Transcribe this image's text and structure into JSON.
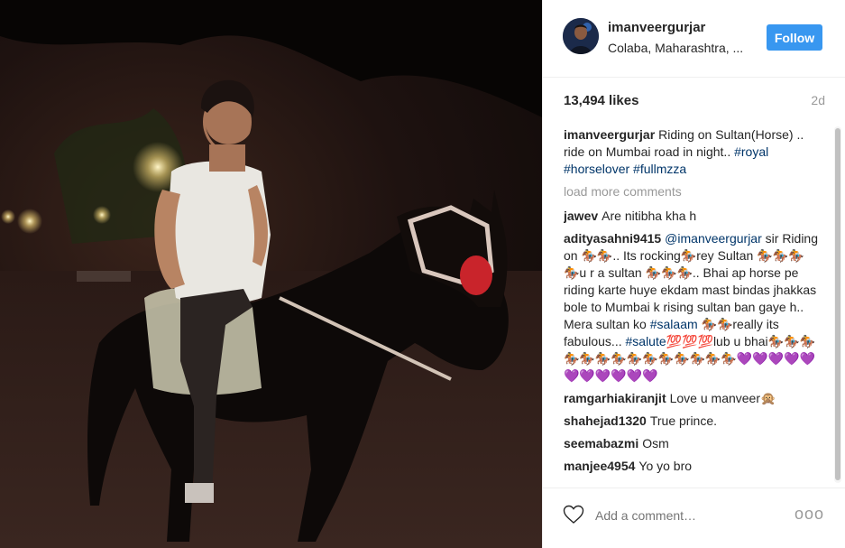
{
  "post": {
    "username": "imanveergurjar",
    "location": "Colaba, Maharashtra, ...",
    "follow_label": "Follow",
    "likes": "13,494 likes",
    "time": "2d"
  },
  "caption": {
    "user": "imanveergurjar",
    "text": "Riding on Sultan(Horse) .. ride on Mumbai road in night..",
    "tags": [
      "#royal",
      "#horselover",
      "#fullmzza"
    ]
  },
  "load_more_label": "load more comments",
  "comments": [
    {
      "user": "jawev",
      "text": "Are nitibha kha h"
    },
    {
      "user": "adityasahni9415",
      "mention": "@imanveergurjar",
      "text_a": " sir Riding on 🏇🏇.. Its rocking🏇rey Sultan 🏇🏇🏇🏇u r a sultan 🏇🏇🏇.. Bhai ap horse pe riding karte huye ekdam mast bindas jhakkas bole to Mumbai k rising sultan ban gaye h.. Mera sultan ko ",
      "tag_a": "#salaam",
      "text_b": " 🏇🏇really its fabulous... ",
      "tag_b": "#salute",
      "text_c": "💯💯💯lub u bhai🏇🏇🏇🏇🏇🏇🏇🏇🏇🏇🏇🏇🏇🏇💜💜💜💜💜💜💜💜💜💜💜"
    },
    {
      "user": "ramgarhiakiranjit",
      "text": "Love u manveer🙊"
    },
    {
      "user": "shahejad1320",
      "text": "True prince."
    },
    {
      "user": "seemabazmi",
      "text": "Osm"
    },
    {
      "user": "manjee4954",
      "text": "Yo yo bro"
    }
  ],
  "add_comment_placeholder": "Add a comment…",
  "more_options": "ooo",
  "colors": {
    "follow": "#3897f0",
    "hashtag": "#003569"
  }
}
